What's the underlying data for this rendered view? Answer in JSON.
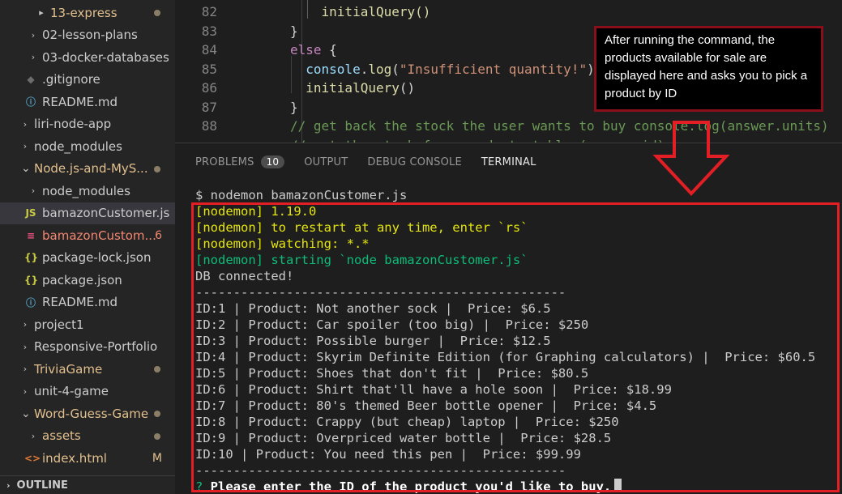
{
  "sidebar": {
    "items": [
      {
        "label": "13-express",
        "chevron": "▸",
        "color": "#e2c08d",
        "dot": true
      },
      {
        "label": "02-lesson-plans",
        "chevron": "›"
      },
      {
        "label": "03-docker-databases",
        "chevron": "›"
      },
      {
        "label": ".gitignore",
        "icon": "◆",
        "icon_name": "gitignore-icon",
        "icon_color": "#6c6c6c"
      },
      {
        "label": "README.md",
        "icon": "ⓘ",
        "icon_name": "info-icon",
        "icon_color": "#519aba"
      },
      {
        "label": "liri-node-app",
        "chevron": "›"
      },
      {
        "label": "node_modules",
        "chevron": "›"
      },
      {
        "label": "Node.js-and-MyS...",
        "chevron": "⌄",
        "color": "#e2c08d",
        "dot": true
      },
      {
        "label": "node_modules",
        "chevron": "›"
      },
      {
        "label": "bamazonCustomer.js",
        "icon": "JS",
        "icon_name": "javascript-file-icon",
        "icon_color": "#cbcb41",
        "active": true
      },
      {
        "label": "bamazonCustom...",
        "icon": "≡",
        "icon_name": "database-file-icon",
        "icon_color": "#f55385",
        "color": "#f48771",
        "status": "6"
      },
      {
        "label": "package-lock.json",
        "icon": "{}",
        "icon_name": "json-file-icon",
        "icon_color": "#cbcb41"
      },
      {
        "label": "package.json",
        "icon": "{}",
        "icon_name": "json-file-icon",
        "icon_color": "#cbcb41"
      },
      {
        "label": "README.md",
        "icon": "ⓘ",
        "icon_name": "info-icon",
        "icon_color": "#519aba"
      },
      {
        "label": "project1",
        "chevron": "›"
      },
      {
        "label": "Responsive-Portfolio",
        "chevron": "›"
      },
      {
        "label": "TriviaGame",
        "chevron": "›",
        "color": "#e2c08d",
        "dot": true
      },
      {
        "label": "unit-4-game",
        "chevron": "›"
      },
      {
        "label": "Word-Guess-Game",
        "chevron": "⌄",
        "color": "#e2c08d",
        "dot": true
      },
      {
        "label": "assets",
        "chevron": "›",
        "color": "#e2c08d",
        "dot": true
      },
      {
        "label": "index.html",
        "icon": "<>",
        "icon_name": "html-file-icon",
        "icon_color": "#e37933",
        "color": "#e2c08d",
        "status": "M"
      }
    ],
    "outline_label": "OUTLINE"
  },
  "editor": {
    "lines": [
      {
        "num": "82",
        "segments": [
          {
            "t": "    initialQuery()",
            "c": "#dcdcaa"
          }
        ]
      },
      {
        "num": "83",
        "segments": [
          {
            "t": "}",
            "c": "#d4d4d4"
          }
        ]
      },
      {
        "num": "84",
        "segments": [
          {
            "t": "else",
            "c": "#c586c0"
          },
          {
            "t": " {",
            "c": "#d4d4d4"
          }
        ]
      },
      {
        "num": "85",
        "segments": [
          {
            "t": "  console",
            "c": "#9cdcfe"
          },
          {
            "t": ".",
            "c": "#d4d4d4"
          },
          {
            "t": "log",
            "c": "#dcdcaa"
          },
          {
            "t": "(",
            "c": "#d4d4d4"
          },
          {
            "t": "\"Insufficient quantity!\"",
            "c": "#ce9178"
          },
          {
            "t": ");",
            "c": "#d4d4d4"
          }
        ]
      },
      {
        "num": "86",
        "segments": [
          {
            "t": "  initialQuery",
            "c": "#dcdcaa"
          },
          {
            "t": "()",
            "c": "#d4d4d4"
          }
        ]
      },
      {
        "num": "87",
        "segments": [
          {
            "t": "}",
            "c": "#d4d4d4"
          }
        ]
      },
      {
        "num": "88",
        "segments": [
          {
            "t": "// get back the stock the user wants to buy console.log(answer.units)",
            "c": "#6a9955"
          }
        ]
      },
      {
        "num": "",
        "segments": [
          {
            "t": "// get the stock from products table (answer.id)",
            "c": "#6a9955"
          }
        ]
      }
    ]
  },
  "panel": {
    "tabs": [
      {
        "label": "PROBLEMS",
        "badge": "10"
      },
      {
        "label": "OUTPUT"
      },
      {
        "label": "DEBUG CONSOLE"
      },
      {
        "label": "TERMINAL",
        "active": true
      }
    ]
  },
  "terminal": {
    "lines": [
      {
        "text": "$ nodemon bamazonCustomer.js",
        "color": "#cccccc"
      },
      {
        "text": "[nodemon] 1.19.0",
        "color": "#e5e510"
      },
      {
        "text": "[nodemon] to restart at any time, enter `rs`",
        "color": "#e5e510"
      },
      {
        "text": "[nodemon] watching: *.*",
        "color": "#e5e510"
      },
      {
        "text": "[nodemon] starting `node bamazonCustomer.js`",
        "color": "#0dbc79"
      },
      {
        "text": "DB connected!",
        "color": "#cccccc"
      },
      {
        "text": "-------------------------------------------------",
        "color": "#cccccc"
      },
      {
        "text": "ID:1 | Product: Not another sock |  Price: $6.5",
        "color": "#cccccc"
      },
      {
        "text": "ID:2 | Product: Car spoiler (too big) |  Price: $250",
        "color": "#cccccc"
      },
      {
        "text": "ID:3 | Product: Possible burger |  Price: $12.5",
        "color": "#cccccc"
      },
      {
        "text": "ID:4 | Product: Skyrim Definite Edition (for Graphing calculators) |  Price: $60.5",
        "color": "#cccccc"
      },
      {
        "text": "ID:5 | Product: Shoes that don't fit |  Price: $80.5",
        "color": "#cccccc"
      },
      {
        "text": "ID:6 | Product: Shirt that'll have a hole soon |  Price: $18.99",
        "color": "#cccccc"
      },
      {
        "text": "ID:7 | Product: 80's themed Beer bottle opener |  Price: $4.5",
        "color": "#cccccc"
      },
      {
        "text": "ID:8 | Product: Crappy (but cheap) laptop |  Price: $250",
        "color": "#cccccc"
      },
      {
        "text": "ID:9 | Product: Overpriced water bottle |  Price: $28.5",
        "color": "#cccccc"
      },
      {
        "text": "ID:10 | Product: You need this pen |  Price: $99.99",
        "color": "#cccccc"
      },
      {
        "text": "-------------------------------------------------",
        "color": "#cccccc"
      }
    ],
    "prompt_mark": "?",
    "prompt_text": " Please enter the ID of the product you'd like to buy.",
    "colors": {
      "prompt_mark": "#0dbc79",
      "prompt_text": "#ffffff"
    }
  },
  "annotation": {
    "note": "After running the command, the products available for sale are displayed here and asks you to pick a product by ID"
  }
}
